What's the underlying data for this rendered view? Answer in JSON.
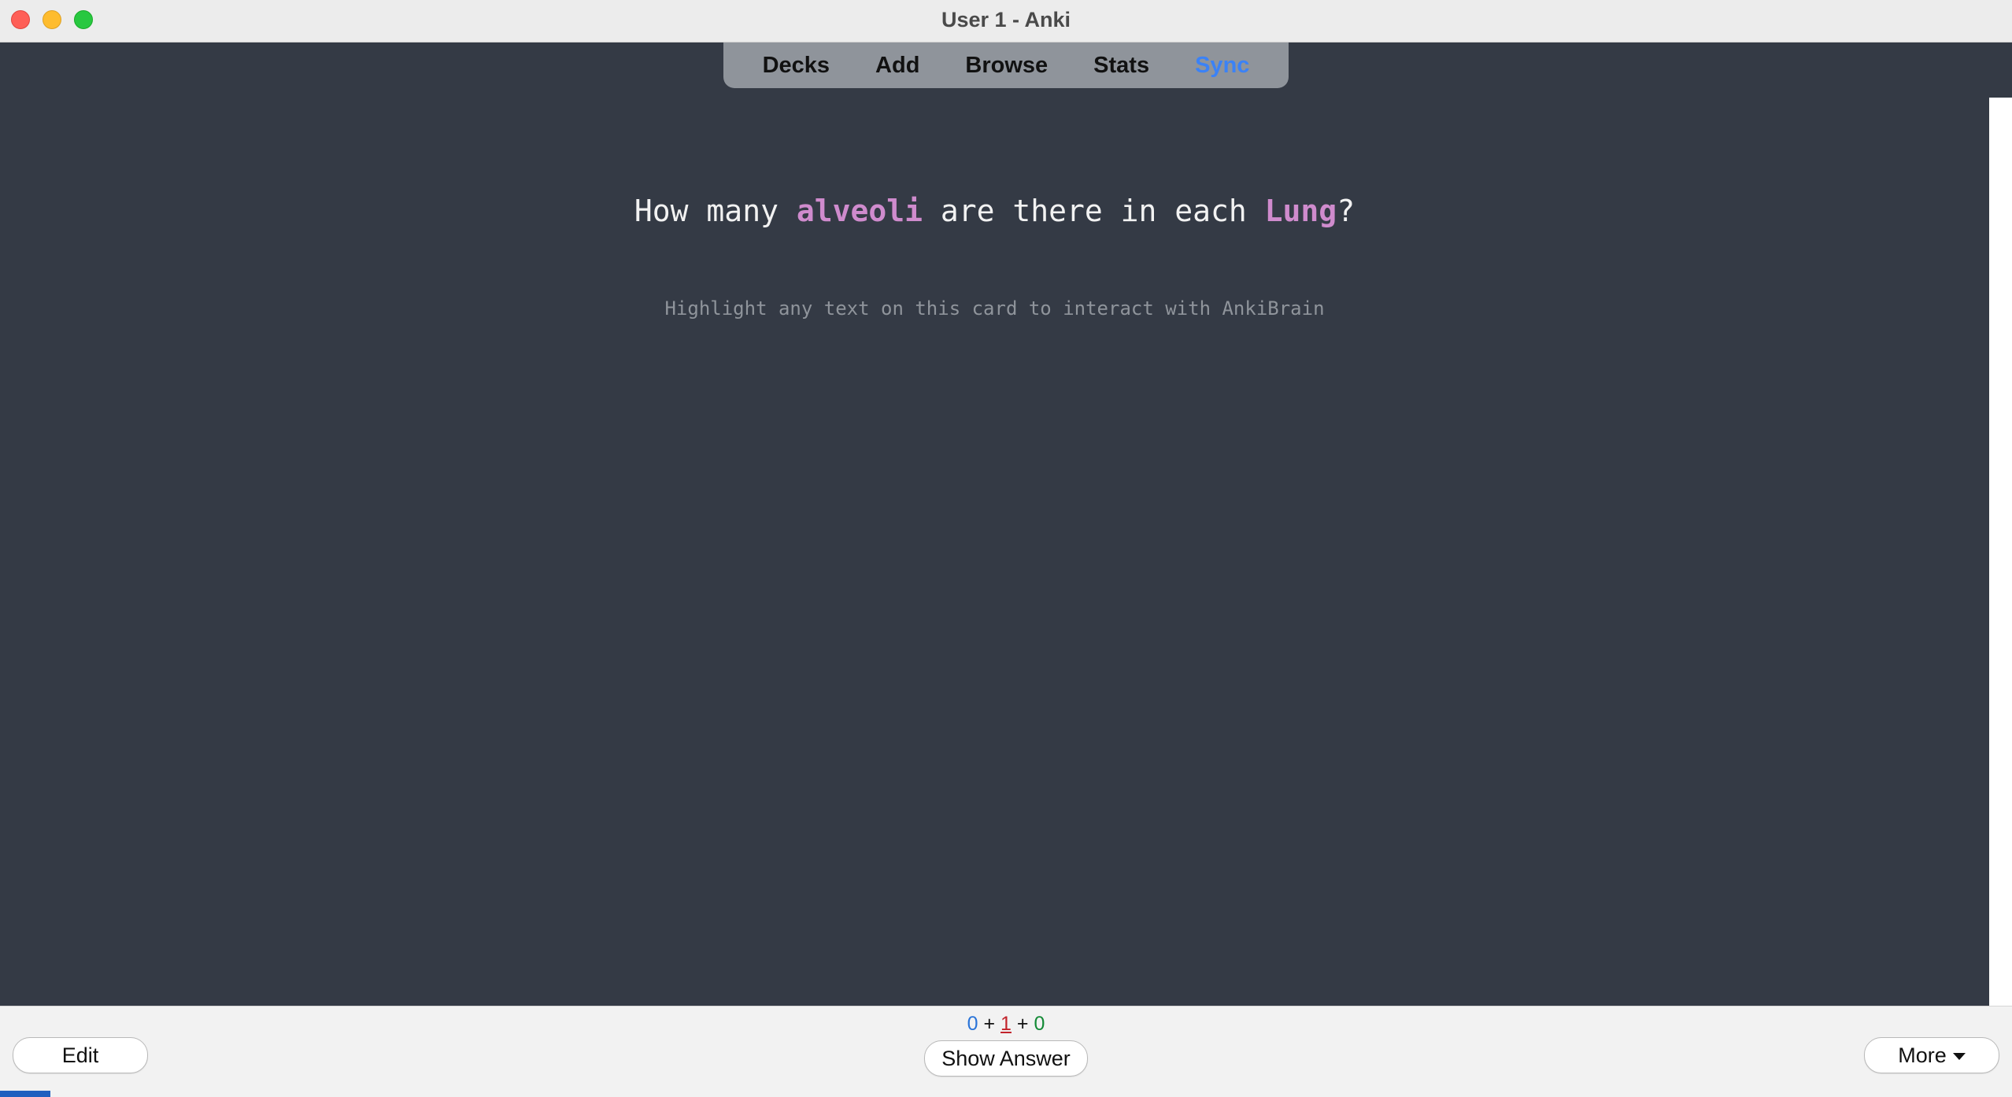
{
  "window": {
    "title": "User 1 - Anki"
  },
  "toolbar": {
    "items": [
      {
        "label": "Decks"
      },
      {
        "label": "Add"
      },
      {
        "label": "Browse"
      },
      {
        "label": "Stats"
      },
      {
        "label": "Sync"
      }
    ],
    "sync_color": "#3b82f6"
  },
  "card": {
    "question": {
      "part1": "How many ",
      "term1": "alveoli",
      "part2": " are there in each ",
      "term2": "Lung",
      "part3": "?"
    },
    "highlight_color": "#cf8bcd",
    "hint": "Highlight any text on this card to interact with AnkiBrain"
  },
  "counts": {
    "new": "0",
    "sep1": " + ",
    "learning": "1",
    "sep2": " + ",
    "review": "0",
    "colors": {
      "new": "#2a74d8",
      "learning": "#c2232b",
      "review": "#138a36"
    }
  },
  "bottom": {
    "edit_label": "Edit",
    "show_answer_label": "Show Answer",
    "more_label": "More"
  },
  "icons": {
    "close": "close-window-icon",
    "minimize": "minimize-window-icon",
    "maximize": "maximize-window-icon",
    "more_caret": "chevron-down-icon"
  }
}
